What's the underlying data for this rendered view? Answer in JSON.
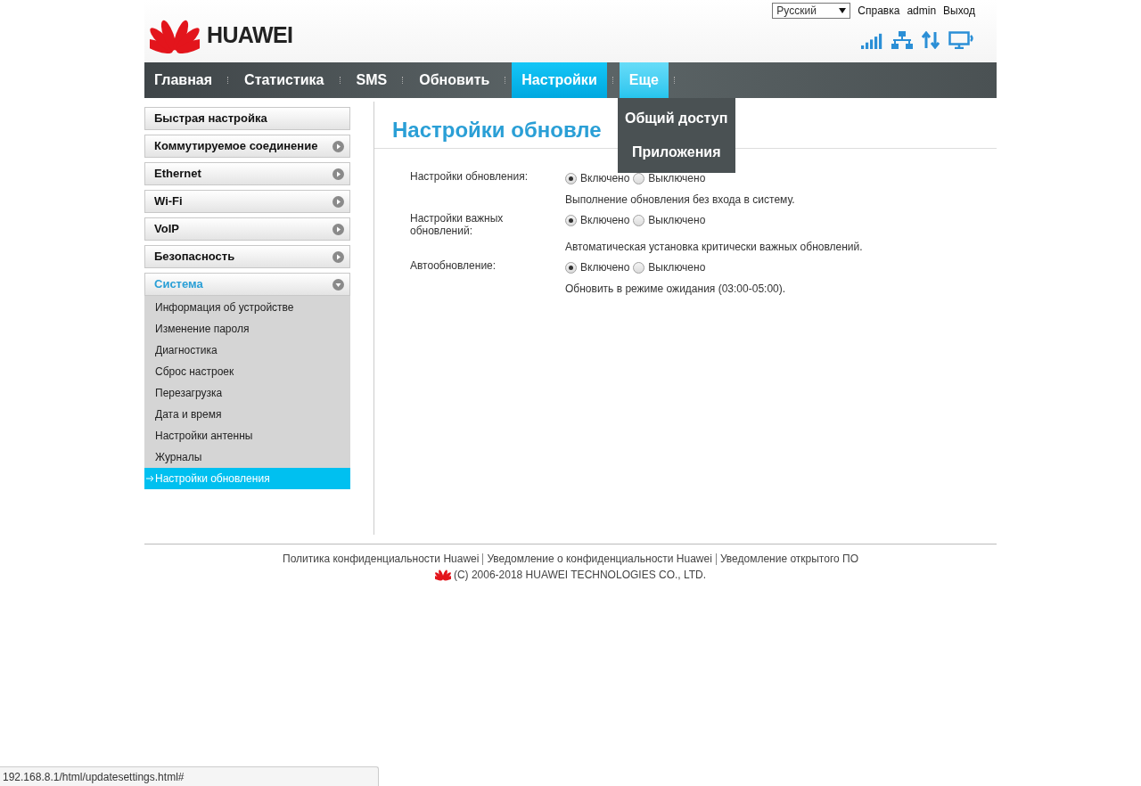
{
  "header": {
    "brand": "HUAWEI",
    "language": "Русский",
    "links": [
      "Справка",
      "admin",
      "Выход"
    ]
  },
  "nav": [
    {
      "label": "Главная",
      "selected": false,
      "expanded": false
    },
    {
      "label": "Статистика",
      "selected": false,
      "expanded": false
    },
    {
      "label": "SMS",
      "selected": false,
      "expanded": false
    },
    {
      "label": "Обновить",
      "selected": false,
      "expanded": false
    },
    {
      "label": "Настройки",
      "selected": true,
      "expanded": false
    },
    {
      "label": "Еще",
      "selected": false,
      "expanded": true,
      "menu": [
        "Общий доступ",
        "Приложения"
      ]
    }
  ],
  "sidebar": [
    {
      "label": "Быстрая настройка",
      "kind": "link"
    },
    {
      "label": "Коммутируемое соединение",
      "kind": "group",
      "expanded": false
    },
    {
      "label": "Ethernet",
      "kind": "group",
      "expanded": false
    },
    {
      "label": "Wi-Fi",
      "kind": "group",
      "expanded": false
    },
    {
      "label": "VoIP",
      "kind": "group",
      "expanded": false
    },
    {
      "label": "Безопасность",
      "kind": "group",
      "expanded": false
    },
    {
      "label": "Система",
      "kind": "group",
      "expanded": true,
      "children": [
        {
          "label": "Информация об устройстве",
          "selected": false
        },
        {
          "label": "Изменение пароля",
          "selected": false
        },
        {
          "label": "Диагностика",
          "selected": false
        },
        {
          "label": "Сброс настроек",
          "selected": false
        },
        {
          "label": "Перезагрузка",
          "selected": false
        },
        {
          "label": "Дата и время",
          "selected": false
        },
        {
          "label": "Настройки антенны",
          "selected": false
        },
        {
          "label": "Журналы",
          "selected": false
        },
        {
          "label": "Настройки обновления",
          "selected": true
        }
      ]
    }
  ],
  "content": {
    "title": "Настройки обновле",
    "settings": [
      {
        "label": "Настройки обновления:",
        "options": [
          {
            "label": "Включено",
            "selected": true
          },
          {
            "label": "Выключено",
            "selected": false
          }
        ],
        "note": "Выполнение обновления без входа в систему."
      },
      {
        "label": "Настройки важных обновлений:",
        "options": [
          {
            "label": "Включено",
            "selected": true
          },
          {
            "label": "Выключено",
            "selected": false
          }
        ],
        "note": "Автоматическая установка критически важных обновлений."
      },
      {
        "label": "Автообновление:",
        "options": [
          {
            "label": "Включено",
            "selected": true
          },
          {
            "label": "Выключено",
            "selected": false
          }
        ],
        "note": "Обновить в режиме ожидания (03:00-05:00)."
      }
    ]
  },
  "footer": {
    "links": [
      "Политика конфиденциальности Huawei",
      "Уведомление о конфиденциальности Huawei",
      "Уведомление открытого ПО"
    ],
    "copyright": "(C) 2006-2018 HUAWEI TECHNOLOGIES CO., LTD."
  },
  "status_url": "192.168.8.1/html/updatesettings.html#"
}
